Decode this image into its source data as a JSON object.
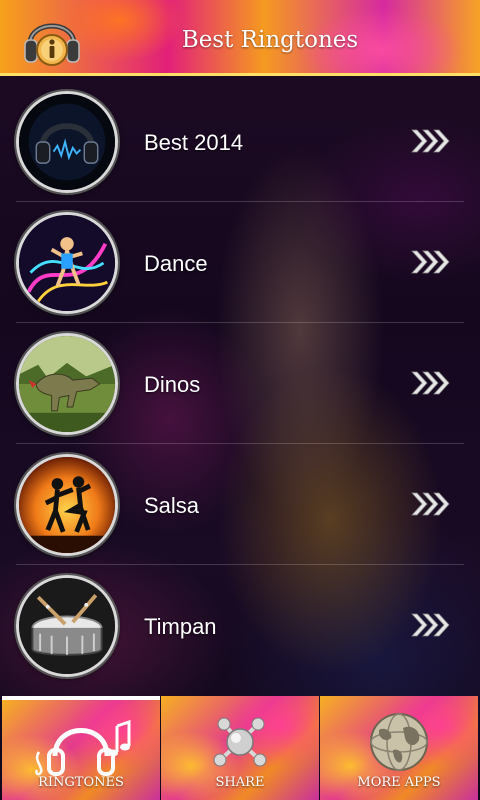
{
  "header": {
    "title": "Best Ringtones",
    "info_icon": "headphones-info-icon"
  },
  "list": {
    "items": [
      {
        "label": "Best 2014",
        "thumb_icon": "headphones-thumbnail",
        "arrow_icon": "triple-chevron-right-icon"
      },
      {
        "label": "Dance",
        "thumb_icon": "dancer-thumbnail",
        "arrow_icon": "triple-chevron-right-icon"
      },
      {
        "label": "Dinos",
        "thumb_icon": "dinosaur-thumbnail",
        "arrow_icon": "triple-chevron-right-icon"
      },
      {
        "label": "Salsa",
        "thumb_icon": "salsa-couple-thumbnail",
        "arrow_icon": "triple-chevron-right-icon"
      },
      {
        "label": "Timpan",
        "thumb_icon": "drum-thumbnail",
        "arrow_icon": "triple-chevron-right-icon"
      }
    ]
  },
  "bottom_bar": {
    "tabs": [
      {
        "label": "RINGTONES",
        "icon": "headphones-music-notes-icon",
        "active": true
      },
      {
        "label": "SHARE",
        "icon": "share-nodes-icon",
        "active": false
      },
      {
        "label": "MORE APPS",
        "icon": "globe-icon",
        "active": false
      }
    ]
  },
  "colors": {
    "accent_orange": "#f6a21b",
    "accent_magenta": "#e2207a",
    "header_border": "#ffe066",
    "text": "#ffffff"
  }
}
